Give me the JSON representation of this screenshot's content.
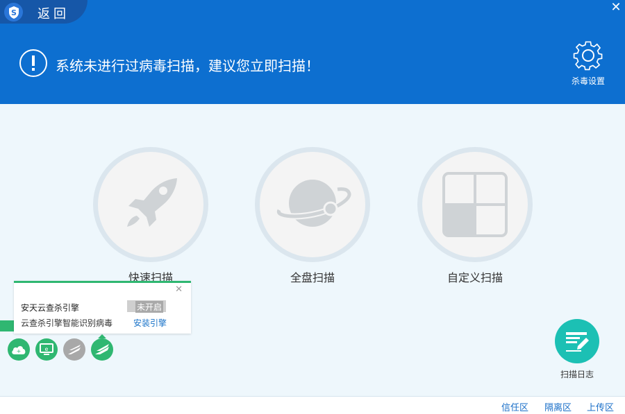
{
  "header": {
    "back_label": "返回",
    "alert_text": "系统未进行过病毒扫描，建议您立即扫描！",
    "settings_label": "杀毒设置"
  },
  "scan_options": [
    {
      "label": "快速扫描",
      "icon": "rocket-icon"
    },
    {
      "label": "全盘扫描",
      "icon": "planet-icon"
    },
    {
      "label": "自定义扫描",
      "icon": "grid-icon"
    }
  ],
  "engine_popup": {
    "title": "安天云查杀引擎",
    "status": "未开启",
    "description": "云查杀引擎智能识别病毒",
    "install_link": "安装引擎"
  },
  "scan_log_label": "扫描日志",
  "footer": {
    "trust_zone": "信任区",
    "quarantine_zone": "隔离区",
    "upload_zone": "上传区"
  },
  "colors": {
    "header_blue": "#0d6fd0",
    "accent_green": "#2fb771",
    "log_teal": "#1cc0b4",
    "link_blue": "#1a73c8"
  }
}
